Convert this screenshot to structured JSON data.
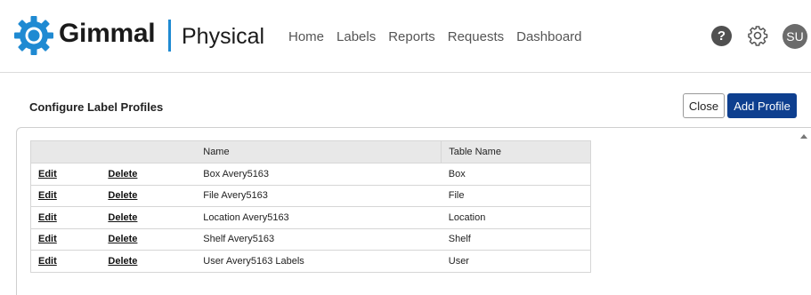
{
  "header": {
    "brand": "Gimmal",
    "product": "Physical",
    "nav": [
      "Home",
      "Labels",
      "Reports",
      "Requests",
      "Dashboard"
    ],
    "help_label": "?",
    "avatar_initials": "SU",
    "brand_color": "#1f8ad2"
  },
  "page": {
    "title": "Configure Label Profiles",
    "close_label": "Close",
    "add_label": "Add Profile",
    "add_color": "#0e3f8f"
  },
  "table": {
    "columns": [
      "",
      "",
      "Name",
      "Table Name"
    ],
    "rows": [
      {
        "edit": "Edit",
        "delete": "Delete",
        "name": "Box Avery5163",
        "table_name": "Box"
      },
      {
        "edit": "Edit",
        "delete": "Delete",
        "name": "File Avery5163",
        "table_name": "File"
      },
      {
        "edit": "Edit",
        "delete": "Delete",
        "name": "Location Avery5163",
        "table_name": "Location"
      },
      {
        "edit": "Edit",
        "delete": "Delete",
        "name": "Shelf Avery5163",
        "table_name": "Shelf"
      },
      {
        "edit": "Edit",
        "delete": "Delete",
        "name": "User Avery5163 Labels",
        "table_name": "User"
      }
    ]
  }
}
